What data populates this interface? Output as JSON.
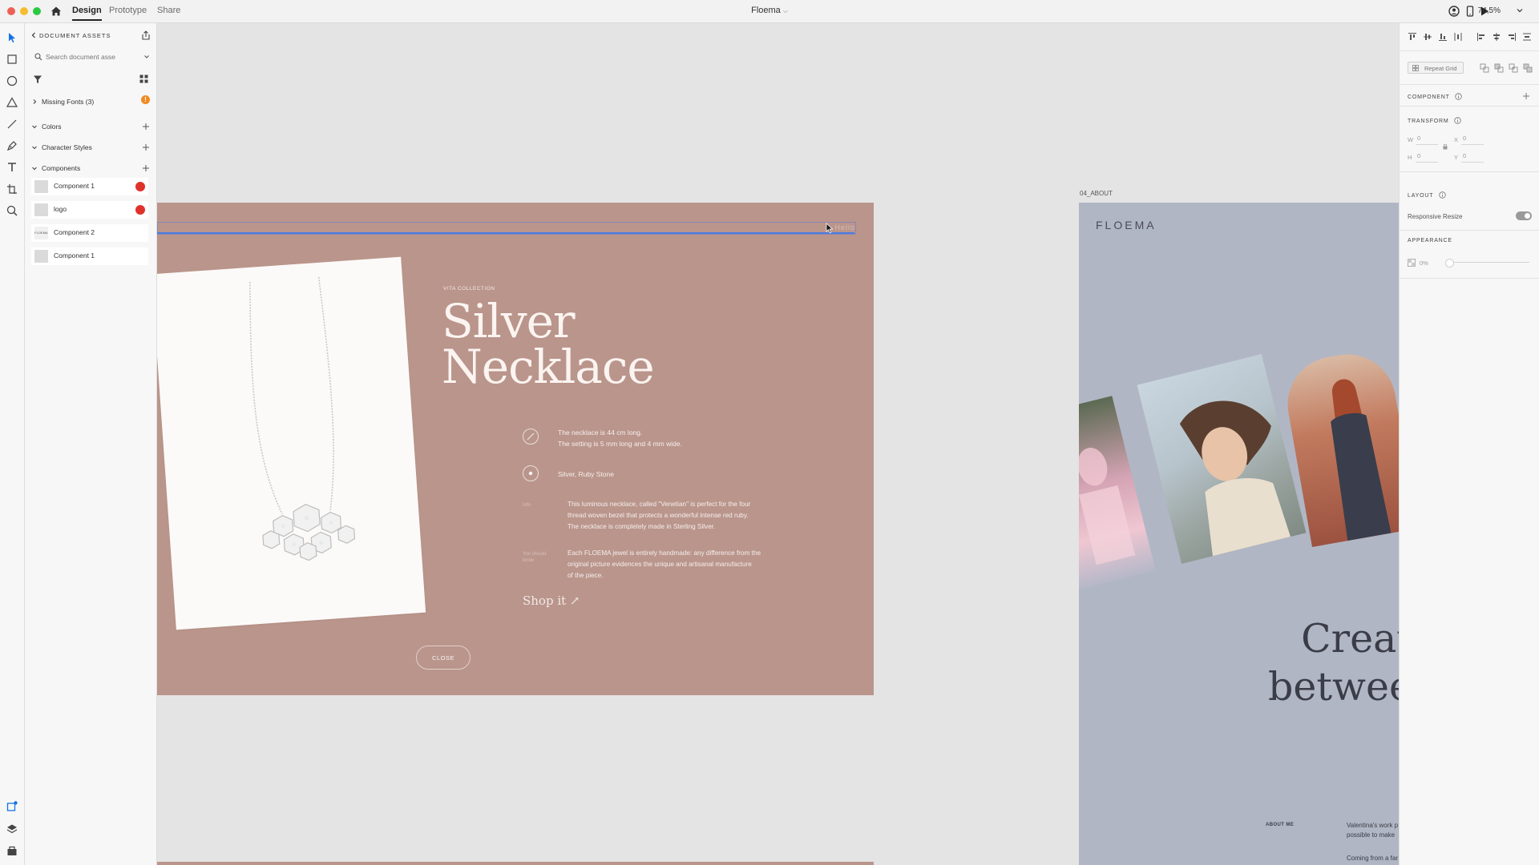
{
  "titlebar": {
    "tabs": [
      {
        "label": "Design",
        "active": true
      },
      {
        "label": "Prototype",
        "active": false
      },
      {
        "label": "Share",
        "active": false
      }
    ],
    "document_title": "Floema",
    "zoom": "74,5%"
  },
  "assets": {
    "header": "DOCUMENT ASSETS",
    "search_placeholder": "Search document asse",
    "missing_fonts": "Missing Fonts (3)",
    "missing_fonts_badge": "!",
    "sections": [
      "Colors",
      "Character Styles",
      "Components"
    ],
    "components": [
      {
        "name": "Component 1",
        "badge": true
      },
      {
        "name": "logo",
        "badge": true
      },
      {
        "name": "Component 2",
        "badge": false,
        "thumb": "FLOEMA"
      },
      {
        "name": "Component 1",
        "badge": false
      }
    ]
  },
  "inspector": {
    "repeat_grid": "Repeat Grid",
    "component_label": "COMPONENT",
    "transform_label": "TRANSFORM",
    "w_label": "W",
    "w_value": "0",
    "x_label": "X",
    "x_value": "0",
    "h_label": "H",
    "h_value": "0",
    "y_label": "Y",
    "y_value": "0",
    "layout_label": "LAYOUT",
    "responsive_resize": "Responsive Resize",
    "responsive_resize_on": true,
    "appearance_label": "APPEARANCE",
    "opacity": "0%"
  },
  "canvas": {
    "product_artboard": {
      "header_text": "Hello",
      "collection": "VITA COLLECTION",
      "title_line1": "Silver",
      "title_line2": "Necklace",
      "size_line1": "The necklace is 44 cm long.",
      "size_line2": "The setting is 5 mm long and 4 mm wide.",
      "material": "Silver, Ruby Stone",
      "info_label": "Info",
      "info_line1": "This luminous necklace, called \"Venetian\" is perfect for the four",
      "info_line2": "thread woven bezel that protects a wonderful intense red ruby.",
      "info_line3": "The necklace is completely made in Sterling Silver.",
      "note_label_line1": "You should",
      "note_label_line2": "know",
      "note_line1": "Each FLOEMA jewel is entirely handmade: any difference from the",
      "note_line2": "original picture evidences the unique and artisanal manufacture",
      "note_line3": "of the piece.",
      "shop": "Shop it ↗",
      "close": "CLOSE"
    },
    "about_artboard": {
      "label": "04_ABOUT",
      "logo": "FLOEMA",
      "headline_line1": "Creat",
      "headline_line2": "betwee",
      "about_label": "ABOUT ME",
      "text_line1": "Valentina's work p",
      "text_line2": "possible to make",
      "text_line3": "Coming from a far"
    }
  },
  "colors": {
    "product_bg": "#ba958b",
    "about_bg": "#b1b6c4",
    "selection": "#4a7be0",
    "badge_red": "#e0322d",
    "warning_orange": "#f08a24"
  }
}
